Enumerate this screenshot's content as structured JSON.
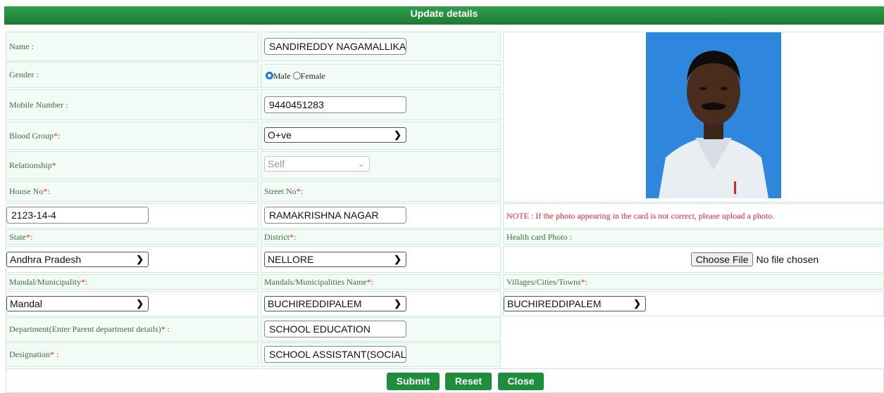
{
  "header": {
    "title": "Update details"
  },
  "labels": {
    "name": "Name :",
    "gender": "Gender :",
    "mobile": "Mobile Number :",
    "blood_group": "Blood Group",
    "relationship": "Relationship",
    "house_no": "House No",
    "street_no": "Street No",
    "state": "State",
    "district": "District",
    "health_photo": "Health card Photo :",
    "mandal": "Mandal/Municipality",
    "mandal_name": "Mandals/Municipalities Name",
    "villages": "Villages/Cities/Towns",
    "department": "Department(Enter Parent department details)",
    "designation": "Designation",
    "required_mark": "*",
    "colon": ":",
    "colon_space": " :"
  },
  "fields": {
    "name": "SANDIREDDY NAGAMALLIKARJ",
    "gender_options": {
      "male": "Male",
      "female": "Female",
      "selected": "Male"
    },
    "mobile": "9440451283",
    "blood_group": "O+ve",
    "relationship": "Self",
    "house_no": "2123-14-4",
    "street_no": "RAMAKRISHNA NAGAR",
    "state": "Andhra Pradesh",
    "district": "NELLORE",
    "mandal": "Mandal",
    "mandal_name": "BUCHIREDDIPALEM",
    "villages": "BUCHIREDDIPALEM",
    "department": "SCHOOL EDUCATION",
    "designation": "SCHOOL ASSISTANT(SOCIAL S"
  },
  "photo_note": "NOTE : If the photo appearing in the card is not correct, please upload a photo.",
  "file_input": {
    "button": "Choose File",
    "status": "No file chosen"
  },
  "buttons": {
    "submit": "Submit",
    "reset": "Reset",
    "close": "Close"
  },
  "colors": {
    "header_green": "#1d7a34",
    "button_green": "#1e8d3c",
    "required_red": "#e8202a"
  }
}
